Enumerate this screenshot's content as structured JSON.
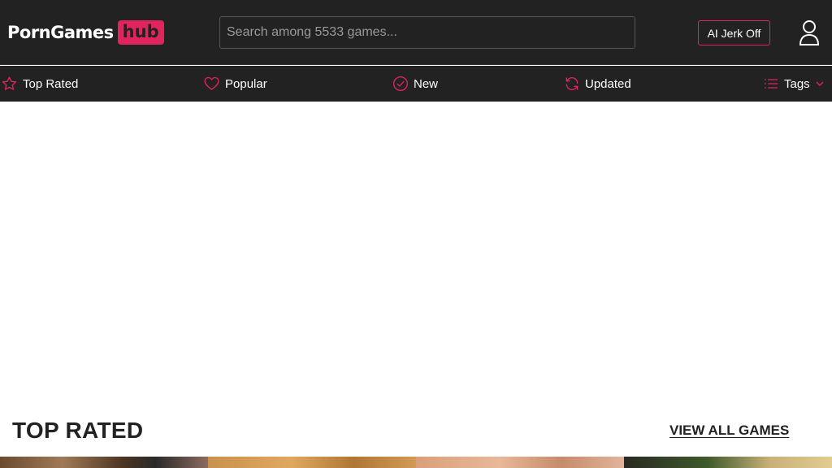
{
  "brand": {
    "name": "PornGames",
    "badge": "hub",
    "accent": "#e0245e"
  },
  "search": {
    "placeholder": "Search among 5533 games..."
  },
  "header": {
    "ai_button": "AI Jerk Off",
    "user_icon": "user-icon"
  },
  "nav": {
    "items": [
      {
        "label": "Top Rated",
        "icon": "star-icon"
      },
      {
        "label": "Popular",
        "icon": "heart-icon"
      },
      {
        "label": "New",
        "icon": "check-circle-icon"
      },
      {
        "label": "Updated",
        "icon": "refresh-icon"
      },
      {
        "label": "Tags",
        "icon": "list-icon"
      }
    ]
  },
  "section": {
    "title": "TOP RATED",
    "view_all": "VIEW ALL GAMES"
  }
}
